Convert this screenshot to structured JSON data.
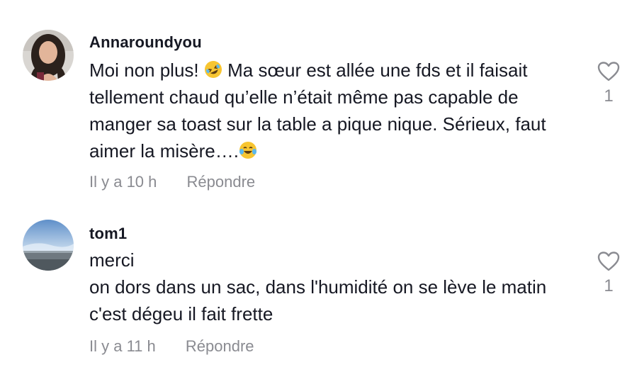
{
  "comments": [
    {
      "username": "Annaroundyou",
      "text_part1": "Moi non plus! ",
      "text_part2": " Ma sœur est allée une fds et il faisait tellement chaud qu’elle n’était même pas capable de manger sa toast sur la table a pique nique. Sérieux, faut aimer la misère….",
      "time": "Il y a 10 h",
      "reply_label": "Répondre",
      "like_count": "1",
      "emoji_1": "rolling-on-floor-laughing-emoji",
      "emoji_2": "tears-of-joy-emoji"
    },
    {
      "username": "tom1",
      "text_line1": "merci",
      "text_line2": "on dors dans un sac, dans l'humidité on se lève le matin c'est dégeu il fait frette",
      "time": "Il y a 11 h",
      "reply_label": "Répondre",
      "like_count": "1"
    }
  ],
  "colors": {
    "text": "#161823",
    "muted": "#8a8b91"
  }
}
